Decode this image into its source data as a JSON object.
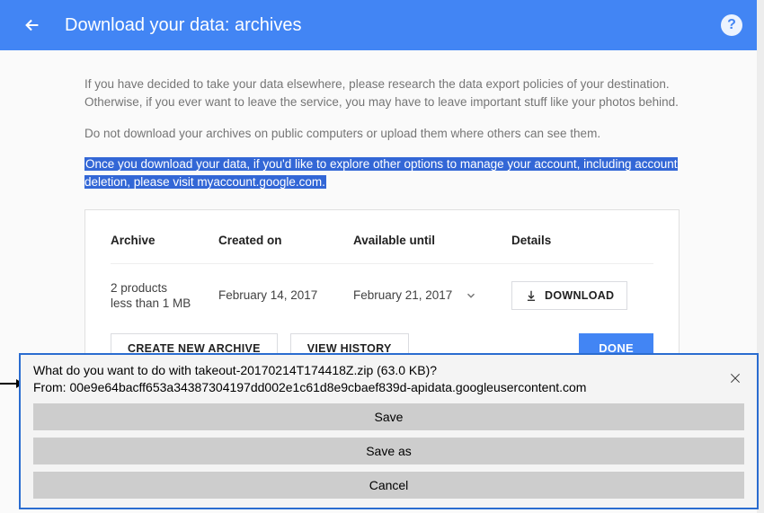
{
  "header": {
    "title": "Download your data: archives"
  },
  "content": {
    "para1": "If you have decided to take your data elsewhere, please research the data export policies of your destination. Otherwise, if you ever want to leave the service, you may have to leave important stuff like your photos behind.",
    "para2": "Do not download your archives on public computers or upload them where others can see them.",
    "para3": "Once you download your data, if you'd like to explore other options to manage your account, including account deletion, please visit myaccount.google.com."
  },
  "table": {
    "headers": {
      "archive": "Archive",
      "created": "Created on",
      "available": "Available until",
      "details": "Details"
    },
    "row": {
      "archive_line1": "2 products",
      "archive_line2": "less than 1 MB",
      "created": "February 14, 2017",
      "available": "February 21, 2017"
    }
  },
  "buttons": {
    "download": "DOWNLOAD",
    "create_new": "CREATE NEW ARCHIVE",
    "view_history": "VIEW HISTORY",
    "done": "DONE"
  },
  "dialog": {
    "line1": "What do you want to do with takeout-20170214T174418Z.zip (63.0 KB)?",
    "line2": "From: 00e9e64bacff653a34387304197dd002e1c61d8e9cbaef839d-apidata.googleusercontent.com",
    "save": "Save",
    "save_as": "Save as",
    "cancel": "Cancel"
  }
}
